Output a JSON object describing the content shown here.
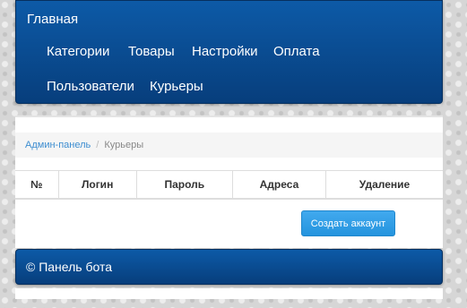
{
  "navbar": {
    "brand": "Главная",
    "items": [
      "Категории",
      "Товары",
      "Настройки",
      "Оплата",
      "Пользователи",
      "Курьеры"
    ]
  },
  "breadcrumb": {
    "parent": "Админ-панель",
    "separator": "/",
    "current": "Курьеры"
  },
  "table": {
    "columns": [
      "№",
      "Логин",
      "Пароль",
      "Адреса",
      "Удаление"
    ]
  },
  "actions": {
    "create_label": "Создать аккаунт"
  },
  "footer": {
    "text": "© Панель бота"
  },
  "colors": {
    "navbar": "#0b4e92",
    "button": "#2f9fe8",
    "link": "#3c8dd0"
  }
}
